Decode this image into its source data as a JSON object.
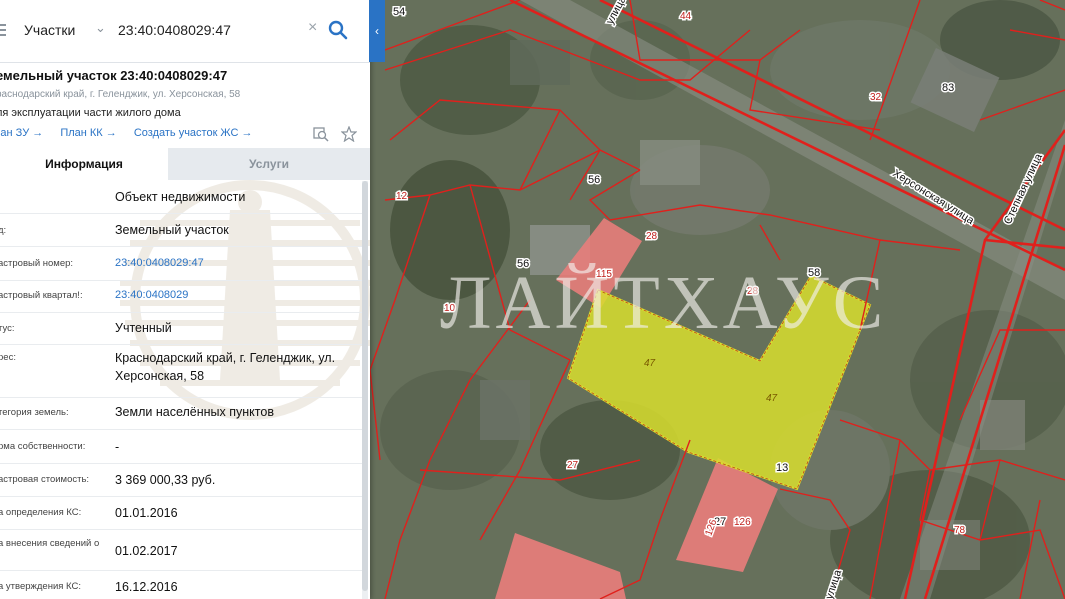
{
  "search": {
    "type": "Участки",
    "value": "23:40:0408029:47"
  },
  "object": {
    "title": "емельный участок 23:40:0408029:47",
    "address_sub": "раснодарский край, г. Геленджик, ул. Херсонская, 58",
    "purpose": "ля эксплуатации части жилого дома"
  },
  "links": {
    "plan_zu": "лан ЗУ",
    "plan_kk": "План КК",
    "create": "Создать участок ЖС",
    "arrow": "→"
  },
  "tabs": {
    "info": "Информация",
    "services": "Услуги"
  },
  "rows": [
    {
      "label": ":",
      "value": "Объект недвижимости"
    },
    {
      "label": "д:",
      "value": "Земельный участок"
    },
    {
      "label": "астровый номер:",
      "value": "23:40:0408029:47"
    },
    {
      "label": "астровый квартал!:",
      "value": "23:40:0408029"
    },
    {
      "label": "тус:",
      "value": "Учтенный"
    },
    {
      "label": "рес:",
      "value": "Краснодарский край, г. Геленджик, ул. Херсонская, 58"
    },
    {
      "label": "тегория земель:",
      "value": "Земли населённых пунктов"
    },
    {
      "label": "рма собственности:",
      "value": "-"
    },
    {
      "label": "астровая стоимость:",
      "value": "3 369 000,33 руб."
    },
    {
      "label": "а определения КС:",
      "value": "01.01.2016"
    },
    {
      "label": "а внесения сведений о",
      "value": "01.02.2017"
    },
    {
      "label": "а утверждения КС:",
      "value": "16.12.2016"
    }
  ],
  "map": {
    "streets": {
      "khersonskaya": "Херсонская улица",
      "stepnaya": "Степная улица",
      "top": "улица",
      "bottom": "улица"
    },
    "parcel_numbers": {
      "n54": "54",
      "n44": "44",
      "n83": "83",
      "n32": "32",
      "n12": "12",
      "n56a": "56",
      "n56b": "56",
      "n28a": "28",
      "n115": "115",
      "n58": "58",
      "n28b": "28",
      "n10": "10",
      "n47a": "47",
      "n47b": "47",
      "n13": "13",
      "n27a": "27",
      "n27b": "27",
      "n126a": "126",
      "n126b": "126",
      "n78": "78"
    },
    "watermark": "ЛАЙТХАУС"
  },
  "colors": {
    "accent": "#2a73c5",
    "boundary": "#e0201c",
    "selected_parcel": "#d8de2e",
    "building": "#ea7d7b"
  },
  "icons": {
    "burger": "menu-icon",
    "chevron": "chevron-down-icon",
    "clear": "close-icon",
    "search": "search-icon",
    "collapse": "chevron-left-icon",
    "zoom": "zoom-to-object-icon",
    "favorite": "star-icon"
  }
}
